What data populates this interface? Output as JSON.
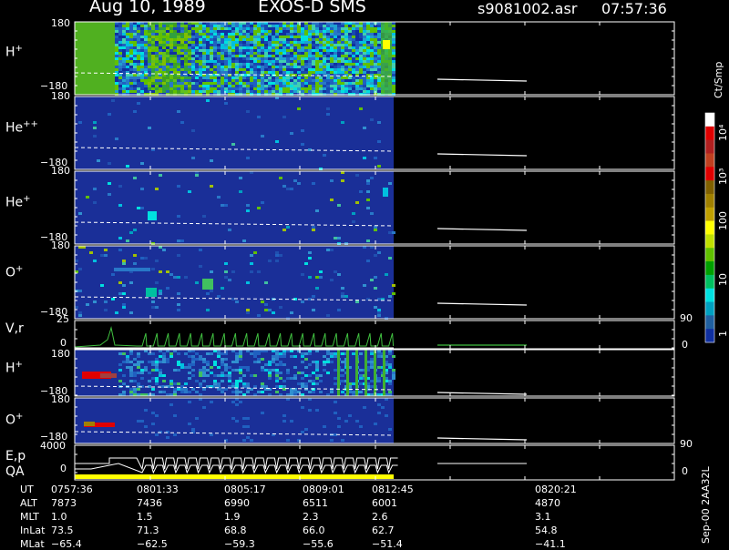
{
  "header": {
    "date": "Aug 10, 1989",
    "instrument": "EXOS-D SMS",
    "file": "s9081002.asr",
    "time": "07:57:36"
  },
  "panels": [
    {
      "id": "hplus",
      "label": "H",
      "sup": "+",
      "ytop": "180",
      "ybot": "−180"
    },
    {
      "id": "hepp",
      "label": "He",
      "sup": "++",
      "ytop": "180",
      "ybot": "−180"
    },
    {
      "id": "heplus",
      "label": "He",
      "sup": "+",
      "ytop": "180",
      "ybot": "−180"
    },
    {
      "id": "oplus",
      "label": "O",
      "sup": "+",
      "ytop": "180",
      "ybot": "−180"
    },
    {
      "id": "vr",
      "label": "V,r",
      "sup": "",
      "ytop": "25",
      "ybot": "0",
      "rtop": "90",
      "rbot": "0"
    },
    {
      "id": "hplus2",
      "label": "H",
      "sup": "+",
      "ytop": "180",
      "ybot": "−180"
    },
    {
      "id": "oplus2",
      "label": "O",
      "sup": "+",
      "ytop": "180",
      "ybot": "−180"
    },
    {
      "id": "ep",
      "label": "E,p",
      "sup": "",
      "label2": "QA",
      "ytop": "4000",
      "ybot": "0",
      "rtop": "90",
      "rbot": "0"
    }
  ],
  "colorbar": {
    "title": "Ct/Smp",
    "labels": [
      "10⁴",
      "10³",
      "100",
      "10",
      "1"
    ],
    "colors": [
      "#ffffff",
      "#e00000",
      "#b02020",
      "#c04020",
      "#e00000",
      "#806000",
      "#a08000",
      "#c0a000",
      "#ffff00",
      "#c0e000",
      "#60c000",
      "#00a000",
      "#00c060",
      "#00e0e0",
      "#00a0c0",
      "#2060a0",
      "#1030a0"
    ]
  },
  "footer": {
    "rows": [
      {
        "name": "UT",
        "values": [
          "0757:36",
          "0801:33",
          "0805:17",
          "0809:01",
          "0812:45",
          "0820:21"
        ]
      },
      {
        "name": "ALT",
        "values": [
          "7873",
          "7436",
          "6990",
          "6511",
          "6001",
          "4870"
        ]
      },
      {
        "name": "MLT",
        "values": [
          "1.0",
          "1.5",
          "1.9",
          "2.3",
          "2.6",
          "3.1"
        ]
      },
      {
        "name": "InLat",
        "values": [
          "73.5",
          "71.3",
          "68.8",
          "66.0",
          "62.7",
          "54.8"
        ]
      },
      {
        "name": "MLat",
        "values": [
          "−65.4",
          "−62.5",
          "−59.3",
          "−55.6",
          "−51.4",
          "−41.1"
        ]
      }
    ],
    "stamp": "Sep-00 2AA32L"
  },
  "chart_data": {
    "type": "heatmap",
    "title": "Aug 10, 1989   EXOS-D SMS",
    "x": [
      "0757:36",
      "0801:33",
      "0805:17",
      "0809:01",
      "0812:45",
      "0820:21"
    ],
    "series": [
      {
        "name": "H+",
        "ylim": [
          -180,
          180
        ]
      },
      {
        "name": "He++",
        "ylim": [
          -180,
          180
        ]
      },
      {
        "name": "He+",
        "ylim": [
          -180,
          180
        ]
      },
      {
        "name": "O+",
        "ylim": [
          -180,
          180
        ]
      },
      {
        "name": "V,r",
        "ylim": [
          0,
          25
        ],
        "right_ylim": [
          0,
          90
        ]
      },
      {
        "name": "H+",
        "ylim": [
          -180,
          180
        ]
      },
      {
        "name": "O+",
        "ylim": [
          -180,
          180
        ]
      },
      {
        "name": "E,p",
        "ylim": [
          0,
          4000
        ],
        "right_ylim": [
          0,
          90
        ]
      }
    ],
    "colorbar_units": "Ct/Smp"
  }
}
